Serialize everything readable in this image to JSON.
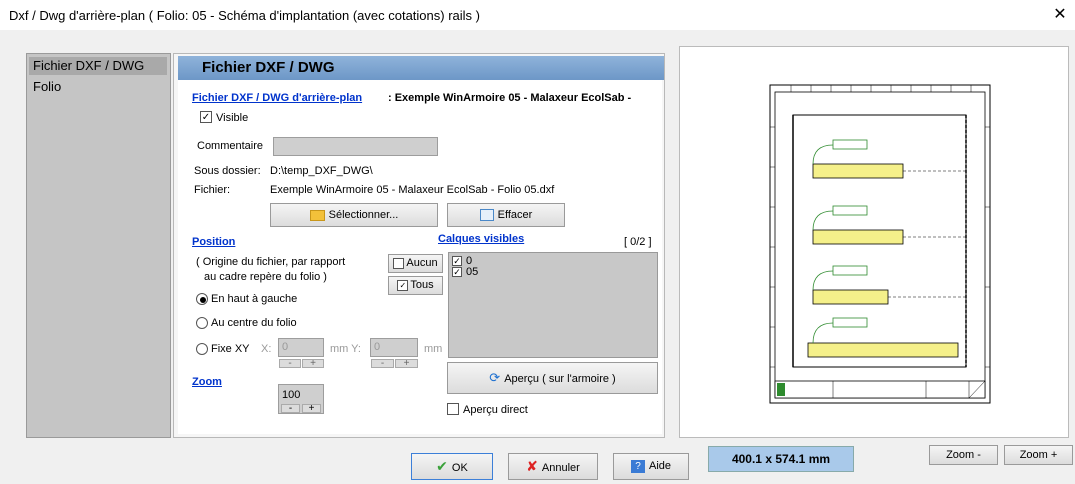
{
  "window": {
    "title": "Dxf / Dwg d'arrière-plan ( Folio: 05 - Schéma d'implantation (avec cotations) rails )",
    "close_glyph": "✕"
  },
  "sidebar": {
    "items": [
      {
        "label": "Fichier DXF / DWG",
        "active": true
      },
      {
        "label": "Folio",
        "active": false
      }
    ]
  },
  "panel": {
    "header": "Fichier DXF / DWG",
    "file_section_link": "Fichier DXF / DWG d'arrière-plan",
    "file_section_value": ": Exemple WinArmoire 05 - Malaxeur EcolSab -",
    "visible_label": "Visible",
    "visible_checked": true,
    "comment_label": "Commentaire",
    "comment_value": "",
    "subfolder_label": "Sous dossier:",
    "subfolder_value": "D:\\temp_DXF_DWG\\",
    "file_label": "Fichier:",
    "file_value": "Exemple WinArmoire 05 - Malaxeur EcolSab - Folio 05.dxf",
    "select_button": "Sélectionner...",
    "clear_button": "Effacer"
  },
  "position": {
    "title": "Position",
    "note_line1": "( Origine du fichier, par rapport",
    "note_line2": "au cadre repère du folio )",
    "options": [
      "En haut à gauche",
      "Au centre du folio",
      "Fixe XY"
    ],
    "selected": "En haut à gauche",
    "x_label": "X:",
    "x_value": "0",
    "y_label": "mm  Y:",
    "y_value": "0",
    "unit": "mm",
    "spin_minus": "-",
    "spin_plus": "+"
  },
  "layers": {
    "title": "Calques visibles",
    "count": "[ 0/2 ]",
    "none_button": "Aucun",
    "all_button": "Tous",
    "items": [
      {
        "name": "0",
        "checked": true
      },
      {
        "name": "05",
        "checked": true
      }
    ]
  },
  "zoom": {
    "title": "Zoom",
    "value": "100",
    "minus": "-",
    "plus": "+"
  },
  "preview": {
    "button": "Aperçu ( sur l'armoire )",
    "direct_label": "Aperçu direct",
    "direct_checked": false
  },
  "footer": {
    "ok": "OK",
    "cancel": "Annuler",
    "help": "Aide",
    "dimensions": "400.1  x 574.1 mm",
    "zoom_minus": "Zoom -",
    "zoom_plus": "Zoom +"
  },
  "colors": {
    "accent_header": "#7ea6d3",
    "link": "#0033cc",
    "dims_bg": "#a9c9ea",
    "rail_fill": "#f5f08a"
  }
}
